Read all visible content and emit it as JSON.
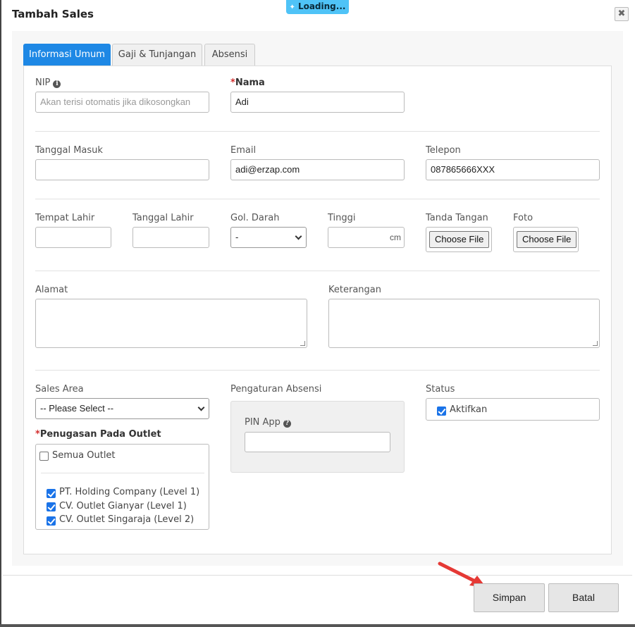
{
  "loading": {
    "label": "Loading..."
  },
  "modal": {
    "title": "Tambah Sales",
    "close_glyph": "✖"
  },
  "tabs": [
    {
      "label": "Informasi Umum",
      "active": true
    },
    {
      "label": "Gaji & Tunjangan",
      "active": false
    },
    {
      "label": "Absensi",
      "active": false
    }
  ],
  "fields": {
    "nip": {
      "label": "NIP",
      "placeholder": "Akan terisi otomatis jika dikosongkan",
      "value": ""
    },
    "nama": {
      "required_mark": "*",
      "label": "Nama",
      "value": "Adi"
    },
    "tanggal_masuk": {
      "label": "Tanggal Masuk",
      "value": ""
    },
    "email": {
      "label": "Email",
      "value": "adi@erzap.com"
    },
    "telepon": {
      "label": "Telepon",
      "value": "087865666XXX"
    },
    "tempat_lahir": {
      "label": "Tempat Lahir",
      "value": ""
    },
    "tanggal_lahir": {
      "label": "Tanggal Lahir",
      "value": ""
    },
    "gol_darah": {
      "label": "Gol. Darah",
      "selected": "-"
    },
    "tinggi": {
      "label": "Tinggi",
      "unit": "cm",
      "value": ""
    },
    "tanda_tangan": {
      "label": "Tanda Tangan",
      "button": "Choose File"
    },
    "foto": {
      "label": "Foto",
      "button": "Choose File"
    },
    "alamat": {
      "label": "Alamat"
    },
    "keterangan": {
      "label": "Keterangan"
    },
    "sales_area": {
      "label": "Sales Area",
      "selected": "-- Please Select --"
    },
    "pengaturan_absensi": {
      "label": "Pengaturan Absensi",
      "pin_label": "PIN App",
      "pin_value": ""
    },
    "status": {
      "label": "Status",
      "checkbox_label": "Aktifkan",
      "checked": true
    }
  },
  "outlets": {
    "required_mark": "*",
    "label": "Penugasan Pada Outlet",
    "all_label": "Semua Outlet",
    "all_checked": false,
    "items": [
      {
        "label": "PT. Holding Company (Level 1)",
        "checked": true
      },
      {
        "label": "CV. Outlet Gianyar (Level 1)",
        "checked": true
      },
      {
        "label": "CV. Outlet Singaraja (Level 2)",
        "checked": true
      }
    ]
  },
  "footer": {
    "save_label": "Simpan",
    "cancel_label": "Batal"
  },
  "colors": {
    "primary_tab": "#1e88e5",
    "loading_bg": "#4fc3f7",
    "required": "#d32f2f",
    "arrow": "#e53935"
  }
}
